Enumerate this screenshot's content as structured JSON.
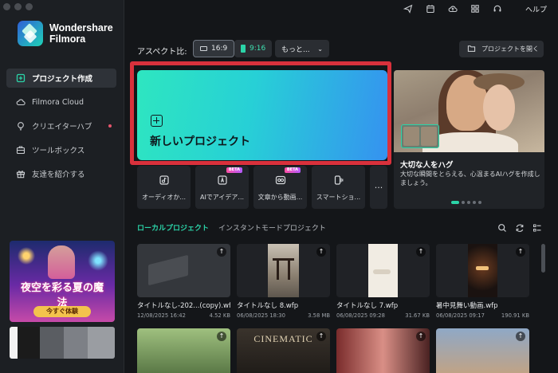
{
  "app": {
    "brand_line1": "Wondershare",
    "brand_line2": "Filmora"
  },
  "sidebar": {
    "items": [
      {
        "label": "プロジェクト作成",
        "icon": "new-project-icon",
        "active": true
      },
      {
        "label": "Filmora Cloud",
        "icon": "cloud-icon",
        "active": false
      },
      {
        "label": "クリエイターハブ",
        "icon": "bulb-icon",
        "active": false,
        "dot": true
      },
      {
        "label": "ツールボックス",
        "icon": "toolbox-icon",
        "active": false
      },
      {
        "label": "友達を紹介する",
        "icon": "gift-icon",
        "active": false
      }
    ],
    "promo": {
      "title": "夜空を彩る夏の魔法",
      "cta": "今すぐ体験"
    }
  },
  "topbar": {
    "icons": [
      "send-icon",
      "calendar-icon",
      "cloud-upload-icon",
      "grid-icon",
      "headset-icon"
    ],
    "help_label": "ヘルプ"
  },
  "aspect": {
    "label": "アスペクト比:",
    "options": [
      {
        "label": "16:9",
        "selected": true
      },
      {
        "label": "9:16",
        "selected": false
      },
      {
        "label": "もっと...",
        "selected": false
      }
    ]
  },
  "open_project_label": "プロジェクトを開く",
  "new_project_label": "新しいプロジェクト",
  "feature": {
    "title": "大切な人をハグ",
    "description": "大切な瞬間をとらえる、心温まるAIハグを作成しましょう。"
  },
  "tools": [
    {
      "label": "オーディオか...",
      "icon": "audio-doc-icon",
      "beta": false
    },
    {
      "label": "AIでアイデア...",
      "icon": "ai-idea-icon",
      "beta": true
    },
    {
      "label": "文章から動画...",
      "icon": "text-to-video-icon",
      "beta": true
    },
    {
      "label": "スマートショ...",
      "icon": "smart-short-icon",
      "beta": false
    },
    {
      "label": "...",
      "icon": "more-icon",
      "beta": false
    }
  ],
  "beta_label": "BETA",
  "tabs": [
    {
      "label": "ローカルプロジェクト",
      "active": true
    },
    {
      "label": "インスタントモードプロジェクト",
      "active": false
    }
  ],
  "projects": [
    {
      "name": "タイトルなし-202...(copy).wfp",
      "date": "12/08/2025 16:42",
      "size": "4.52 KB",
      "thumb_color": "#3a3d42"
    },
    {
      "name": "タイトルなし 8.wfp",
      "date": "06/08/2025 18:30",
      "size": "3.58 MB",
      "thumb_color": "#8a8378"
    },
    {
      "name": "タイトルなし 7.wfp",
      "date": "06/08/2025 09:28",
      "size": "31.67 KB",
      "thumb_color": "#efe9df"
    },
    {
      "name": "暑中見舞い動画.wfp",
      "date": "06/08/2025 09:17",
      "size": "190.91 KB",
      "thumb_color": "#1a1512"
    },
    {
      "name": "",
      "date": "",
      "size": "",
      "thumb_color": "#5b7a4a"
    },
    {
      "name": "",
      "date": "",
      "size": "",
      "thumb_color": "#2a2622"
    },
    {
      "name": "",
      "date": "",
      "size": "",
      "thumb_color": "#b0665e"
    },
    {
      "name": "",
      "date": "",
      "size": "",
      "thumb_color": "#6a86a8"
    }
  ],
  "cinematic_text": "CINEMATIC",
  "colors": {
    "accent": "#2bd4a8",
    "highlight_frame": "#d9313c",
    "background": "#141619"
  }
}
